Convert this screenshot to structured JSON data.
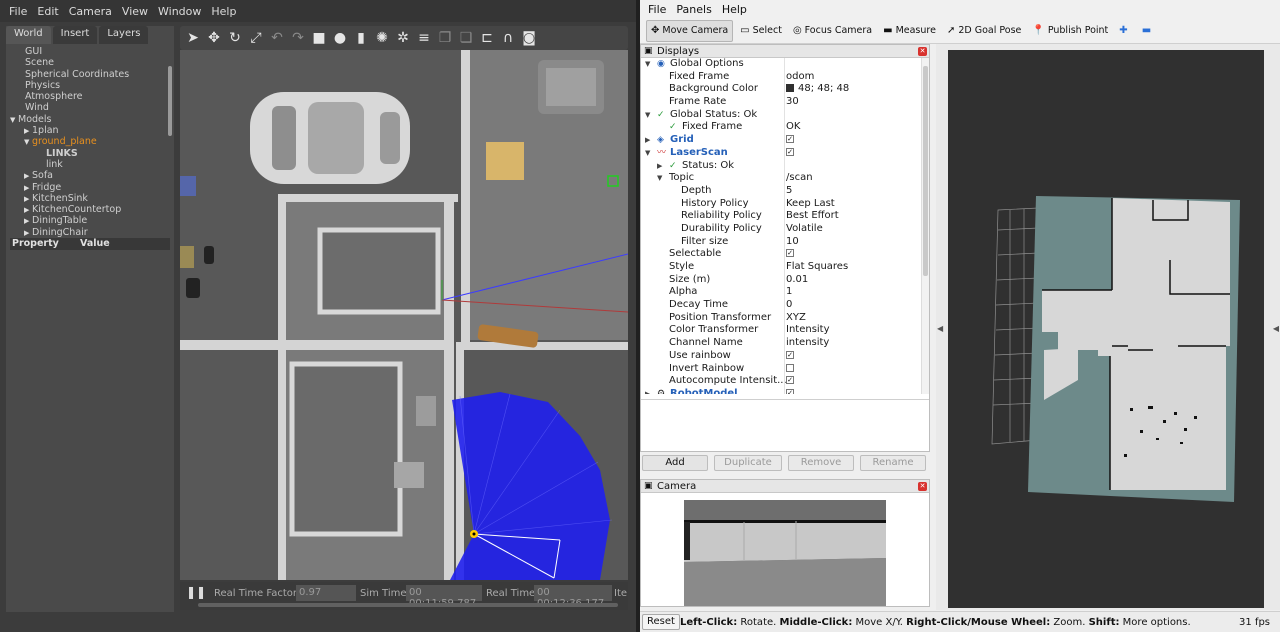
{
  "gazebo": {
    "menu": [
      "File",
      "Edit",
      "Camera",
      "View",
      "Window",
      "Help"
    ],
    "tabs": [
      "World",
      "Insert",
      "Layers"
    ],
    "tree": [
      {
        "label": "GUI",
        "indent": 1,
        "arrow": ""
      },
      {
        "label": "Scene",
        "indent": 1,
        "arrow": ""
      },
      {
        "label": "Spherical Coordinates",
        "indent": 1,
        "arrow": ""
      },
      {
        "label": "Physics",
        "indent": 1,
        "arrow": ""
      },
      {
        "label": "Atmosphere",
        "indent": 1,
        "arrow": ""
      },
      {
        "label": "Wind",
        "indent": 1,
        "arrow": ""
      },
      {
        "label": "Models",
        "indent": 0,
        "arrow": "▼"
      },
      {
        "label": "1plan",
        "indent": 2,
        "arrow": "▶"
      },
      {
        "label": "ground_plane",
        "indent": 2,
        "arrow": "▼",
        "highlight": true
      },
      {
        "label": "LINKS",
        "indent": 4,
        "arrow": "",
        "bold": true
      },
      {
        "label": "link",
        "indent": 4,
        "arrow": ""
      },
      {
        "label": "Sofa",
        "indent": 2,
        "arrow": "▶"
      },
      {
        "label": "Fridge",
        "indent": 2,
        "arrow": "▶"
      },
      {
        "label": "KitchenSink",
        "indent": 2,
        "arrow": "▶"
      },
      {
        "label": "KitchenCountertop",
        "indent": 2,
        "arrow": "▶"
      },
      {
        "label": "DiningTable",
        "indent": 2,
        "arrow": "▶"
      },
      {
        "label": "DiningChair",
        "indent": 2,
        "arrow": "▶"
      }
    ],
    "property_header": {
      "property": "Property",
      "value": "Value"
    },
    "status": {
      "rtf_label": "Real Time Factor:",
      "rtf": "0.97",
      "sim_label": "Sim Time:",
      "sim": "00 00:11:59.787",
      "real_label": "Real Time:",
      "real": "00 00:12:36.177",
      "iter_label": "Ite"
    }
  },
  "rviz": {
    "menu": [
      "File",
      "Panels",
      "Help"
    ],
    "toolbar": [
      {
        "label": "Move Camera",
        "icon": "move-camera-icon",
        "glyph": "✥",
        "active": true
      },
      {
        "label": "Select",
        "icon": "select-icon",
        "glyph": "▭"
      },
      {
        "label": "Focus Camera",
        "icon": "focus-camera-icon",
        "glyph": "◎"
      },
      {
        "label": "Measure",
        "icon": "measure-icon",
        "glyph": "▬"
      },
      {
        "label": "2D Goal Pose",
        "icon": "goal-pose-icon",
        "glyph": "➚"
      },
      {
        "label": "Publish Point",
        "icon": "publish-point-icon",
        "glyph": "📍"
      },
      {
        "label": "",
        "icon": "plus-icon",
        "glyph": "✚"
      },
      {
        "label": "",
        "icon": "minus-icon",
        "glyph": "▬"
      }
    ],
    "displays_title": "Displays",
    "rows": [
      {
        "a": "▼",
        "i": 0,
        "icon": "◉",
        "k": "Global Options",
        "v": ""
      },
      {
        "a": "",
        "i": 1,
        "k": "Fixed Frame",
        "v": "odom"
      },
      {
        "a": "",
        "i": 1,
        "k": "Background Color",
        "v": "48; 48; 48",
        "swatch": "#303030"
      },
      {
        "a": "",
        "i": 1,
        "k": "Frame Rate",
        "v": "30"
      },
      {
        "a": "▼",
        "i": 0,
        "icon": "✓",
        "ok": true,
        "k": "Global Status: Ok",
        "v": ""
      },
      {
        "a": "",
        "i": 1,
        "icon": "✓",
        "ok": true,
        "k": "Fixed Frame",
        "v": "OK"
      },
      {
        "a": "▶",
        "i": 0,
        "icon": "◈",
        "k": "Grid",
        "v": "",
        "blue": true,
        "check": true
      },
      {
        "a": "▼",
        "i": 0,
        "icon": "〰",
        "k": "LaserScan",
        "v": "",
        "blue": true,
        "check": true
      },
      {
        "a": "▶",
        "i": 1,
        "icon": "✓",
        "ok": true,
        "k": "Status: Ok",
        "v": ""
      },
      {
        "a": "▼",
        "i": 1,
        "k": "Topic",
        "v": "/scan"
      },
      {
        "a": "",
        "i": 2,
        "k": "Depth",
        "v": "5"
      },
      {
        "a": "",
        "i": 2,
        "k": "History Policy",
        "v": "Keep Last"
      },
      {
        "a": "",
        "i": 2,
        "k": "Reliability Policy",
        "v": "Best Effort"
      },
      {
        "a": "",
        "i": 2,
        "k": "Durability Policy",
        "v": "Volatile"
      },
      {
        "a": "",
        "i": 2,
        "k": "Filter size",
        "v": "10"
      },
      {
        "a": "",
        "i": 1,
        "k": "Selectable",
        "v": "",
        "check": true
      },
      {
        "a": "",
        "i": 1,
        "k": "Style",
        "v": "Flat Squares"
      },
      {
        "a": "",
        "i": 1,
        "k": "Size (m)",
        "v": "0.01"
      },
      {
        "a": "",
        "i": 1,
        "k": "Alpha",
        "v": "1"
      },
      {
        "a": "",
        "i": 1,
        "k": "Decay Time",
        "v": "0"
      },
      {
        "a": "",
        "i": 1,
        "k": "Position Transformer",
        "v": "XYZ"
      },
      {
        "a": "",
        "i": 1,
        "k": "Color Transformer",
        "v": "Intensity"
      },
      {
        "a": "",
        "i": 1,
        "k": "Channel Name",
        "v": "intensity"
      },
      {
        "a": "",
        "i": 1,
        "k": "Use rainbow",
        "v": "",
        "check": true
      },
      {
        "a": "",
        "i": 1,
        "k": "Invert Rainbow",
        "v": "",
        "check": false
      },
      {
        "a": "",
        "i": 1,
        "k": "Autocompute Intensit...",
        "v": "",
        "check": true
      },
      {
        "a": "▶",
        "i": 0,
        "icon": "⚙",
        "k": "RobotModel",
        "v": "",
        "blue": true,
        "check": true
      }
    ],
    "buttons": {
      "add": "Add",
      "duplicate": "Duplicate",
      "remove": "Remove",
      "rename": "Rename"
    },
    "camera_title": "Camera",
    "status": {
      "reset": "Reset",
      "hint1_b": "Left-Click:",
      "hint1": " Rotate. ",
      "hint2_b": "Middle-Click:",
      "hint2": " Move X/Y. ",
      "hint3_b": "Right-Click/Mouse Wheel:",
      "hint3": " Zoom. ",
      "hint4_b": "Shift:",
      "hint4": " More options.",
      "fps": "31 fps"
    }
  }
}
